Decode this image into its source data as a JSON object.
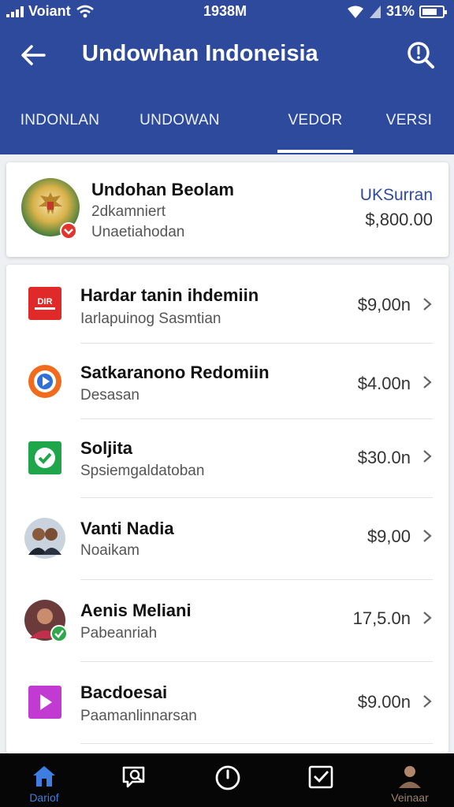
{
  "status": {
    "carrier": "Voiant",
    "time": "1938M",
    "battery": "31%"
  },
  "header": {
    "title": "Undowhan Indoneisia",
    "back_icon": "arrow-left-icon",
    "search_icon": "search-icon"
  },
  "tabs": [
    {
      "label": "INDONLAN",
      "active": false
    },
    {
      "label": "UNDOWAN",
      "active": false
    },
    {
      "label": "VEDOR",
      "active": true
    },
    {
      "label": "VERSI",
      "active": false
    }
  ],
  "summary": {
    "name": "Undohan Beolam",
    "line1": "2dkamniert",
    "line2": "Unaetiahodan",
    "link": "UKSurran",
    "amount": "$,800.00"
  },
  "items": [
    {
      "name": "Hardar tanin ihdemiin",
      "sub": "Iarlapuinog Sasmtian",
      "amount": "$9,00n",
      "icon": "red-logo-icon"
    },
    {
      "name": "Satkaranono Redomiin",
      "sub": "Desasan",
      "amount": "$4.00n",
      "icon": "play-circle-icon"
    },
    {
      "name": "Soljita",
      "sub": "Spsiemgaldatoban",
      "amount": "$30.0n",
      "icon": "green-check-icon"
    },
    {
      "name": "Vanti Nadia",
      "sub": "Noaikam",
      "amount": "$9,00",
      "icon": "couple-avatar-icon"
    },
    {
      "name": "Aenis Meliani",
      "sub": "Pabeanriah",
      "amount": "17,5.0n",
      "icon": "woman-avatar-icon"
    },
    {
      "name": "Bacdoesai",
      "sub": "Paamanlinnarsan",
      "amount": "$9.00n",
      "icon": "purple-play-icon"
    }
  ],
  "nav": [
    {
      "label": "Dariof",
      "icon": "home-icon",
      "active": true
    },
    {
      "label": "",
      "icon": "search-chat-icon",
      "active": false
    },
    {
      "label": "",
      "icon": "clock-icon",
      "active": false
    },
    {
      "label": "",
      "icon": "checkbox-icon",
      "active": false
    },
    {
      "label": "Veinaar",
      "icon": "profile-icon",
      "active": false
    }
  ],
  "colors": {
    "header": "#2e4a9c",
    "accent": "#2e4a9c",
    "nav_active": "#3d7fe0"
  }
}
